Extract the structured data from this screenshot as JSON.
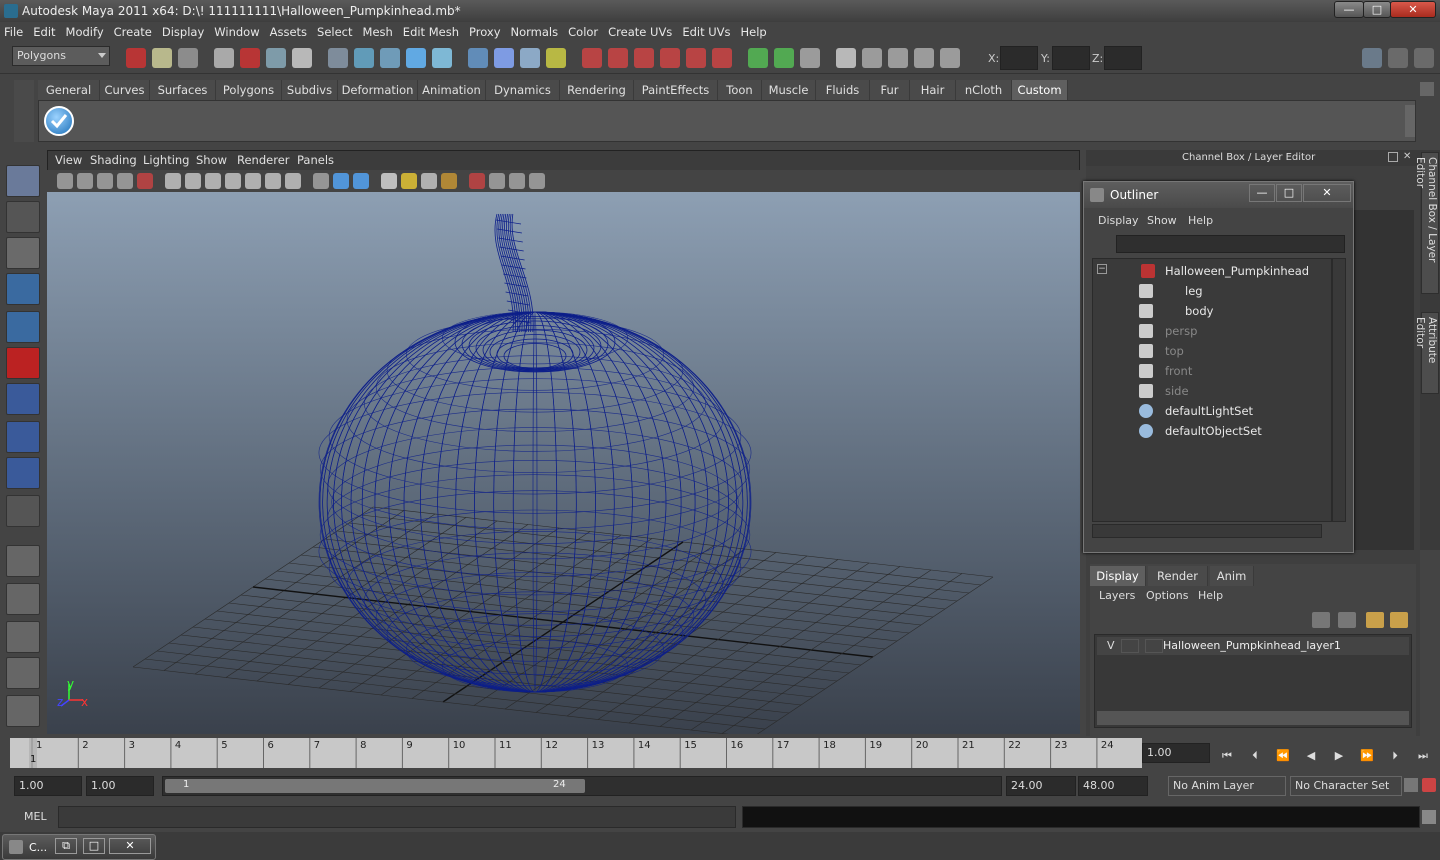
{
  "window": {
    "title": "Autodesk Maya 2011 x64: D:\\! 111111111\\Halloween_Pumpkinhead.mb*",
    "minimize": "—",
    "maximize": "□",
    "close": "✕"
  },
  "menu": [
    "File",
    "Edit",
    "Modify",
    "Create",
    "Display",
    "Window",
    "Assets",
    "Select",
    "Mesh",
    "Edit Mesh",
    "Proxy",
    "Normals",
    "Color",
    "Create UVs",
    "Edit UVs",
    "Help"
  ],
  "status": {
    "mode": "Polygons",
    "x_label": "X:",
    "y_label": "Y:",
    "z_label": "Z:"
  },
  "shelf": {
    "tabs": [
      "General",
      "Curves",
      "Surfaces",
      "Polygons",
      "Subdivs",
      "Deformation",
      "Animation",
      "Dynamics",
      "Rendering",
      "PaintEffects",
      "Toon",
      "Muscle",
      "Fluids",
      "Fur",
      "Hair",
      "nCloth",
      "Custom"
    ],
    "active": "Custom"
  },
  "panel": {
    "menu": [
      "View",
      "Shading",
      "Lighting",
      "Show",
      "Renderer",
      "Panels"
    ],
    "axis_y": "y",
    "axis_x": "x",
    "axis_z": "z"
  },
  "dock": {
    "title": "Channel Box / Layer Editor",
    "side_tab_1": "Channel Box / Layer Editor",
    "side_tab_2": "Attribute Editor"
  },
  "outliner": {
    "title": "Outliner",
    "menu": [
      "Display",
      "Show",
      "Help"
    ],
    "items": [
      {
        "label": "Halloween_Pumpkinhead",
        "icon": "group-icon",
        "dim": false
      },
      {
        "label": "leg",
        "icon": "mesh-icon",
        "dim": false
      },
      {
        "label": "body",
        "icon": "mesh-icon",
        "dim": false
      },
      {
        "label": "persp",
        "icon": "camera-icon",
        "dim": true
      },
      {
        "label": "top",
        "icon": "camera-icon",
        "dim": true
      },
      {
        "label": "front",
        "icon": "camera-icon",
        "dim": true
      },
      {
        "label": "side",
        "icon": "camera-icon",
        "dim": true
      },
      {
        "label": "defaultLightSet",
        "icon": "set-icon",
        "dim": false
      },
      {
        "label": "defaultObjectSet",
        "icon": "set-icon",
        "dim": false
      }
    ]
  },
  "layers": {
    "tabs": [
      "Display",
      "Render",
      "Anim"
    ],
    "active": "Display",
    "menu": [
      "Layers",
      "Options",
      "Help"
    ],
    "layer_name": "Halloween_Pumpkinhead_layer1",
    "visible": "V"
  },
  "timeline": {
    "ticks": [
      "1",
      "2",
      "3",
      "4",
      "5",
      "6",
      "7",
      "8",
      "9",
      "10",
      "11",
      "12",
      "13",
      "14",
      "15",
      "16",
      "17",
      "18",
      "19",
      "20",
      "21",
      "22",
      "23",
      "24"
    ],
    "current": "1",
    "current_frame": "1.00"
  },
  "range": {
    "start": "1.00",
    "start2": "1.00",
    "slider_start": "1",
    "slider_end": "24",
    "end": "24.00",
    "end2": "48.00",
    "anim_layer": "No Anim Layer",
    "char_set": "No Character Set"
  },
  "cmd": {
    "label": "MEL"
  },
  "taskbar": {
    "item": "C..."
  }
}
